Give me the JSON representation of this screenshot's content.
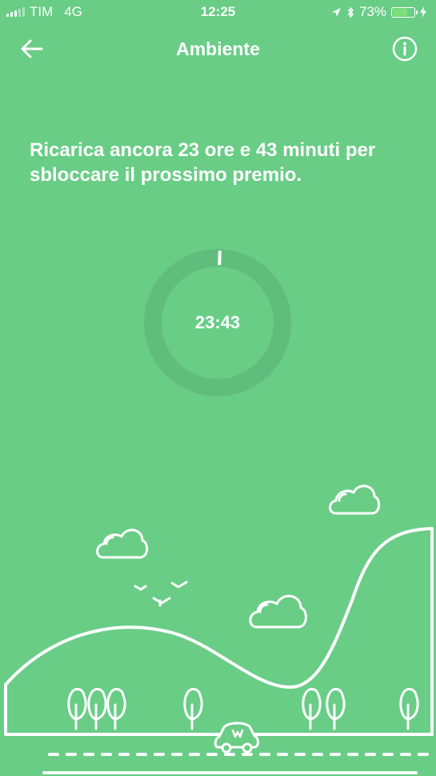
{
  "status_bar": {
    "carrier": "TIM",
    "network": "4G",
    "time": "12:25",
    "battery_percent": "73%",
    "battery_level": 0.73,
    "signal_bars_active": 3,
    "signal_bars_total": 5
  },
  "nav": {
    "title": "Ambiente",
    "back_icon": "arrow-left-icon",
    "info_icon": "info-circle-icon"
  },
  "main": {
    "message": "Ricarica ancora 23 ore e 43 minuti per sbloccare il prossimo premio.",
    "timer": "23:43",
    "progress": 0.01
  },
  "colors": {
    "background": "#69cd86",
    "ring_track": "#5fbe7b",
    "foreground": "#ffffff"
  }
}
